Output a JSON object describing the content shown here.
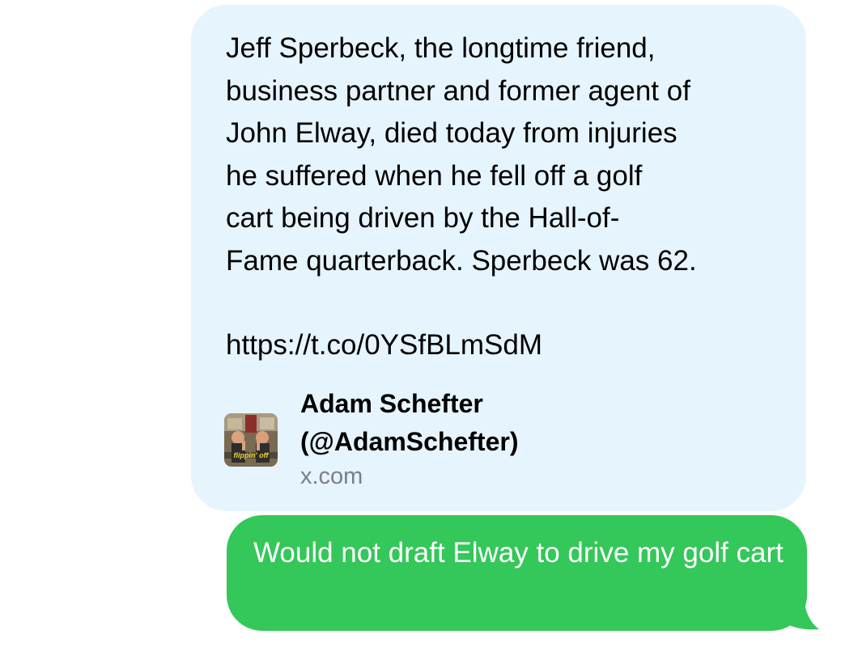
{
  "link_message": {
    "text": "Jeff Sperbeck, the longtime friend,\nbusiness partner and former agent of\nJohn Elway, died today from injuries\nhe suffered when he fell off a golf\ncart being driven by the Hall-of-\nFame quarterback. Sperbeck was 62.",
    "url": "https://t.co/0YSfBLmSdM",
    "preview": {
      "title_line1": "Adam Schefter",
      "title_line2": "(@AdamSchefter)",
      "domain": "x.com",
      "thumbnail_icon": "avatar-thumbnail",
      "thumbnail_text": "flippin' off"
    }
  },
  "sent_message": {
    "text": "Would not draft Elway to drive my golf cart"
  },
  "colors": {
    "link_bubble_bg": "#e6f4fd",
    "sent_bubble_bg": "#34c759",
    "domain_text": "#7a7f85"
  }
}
